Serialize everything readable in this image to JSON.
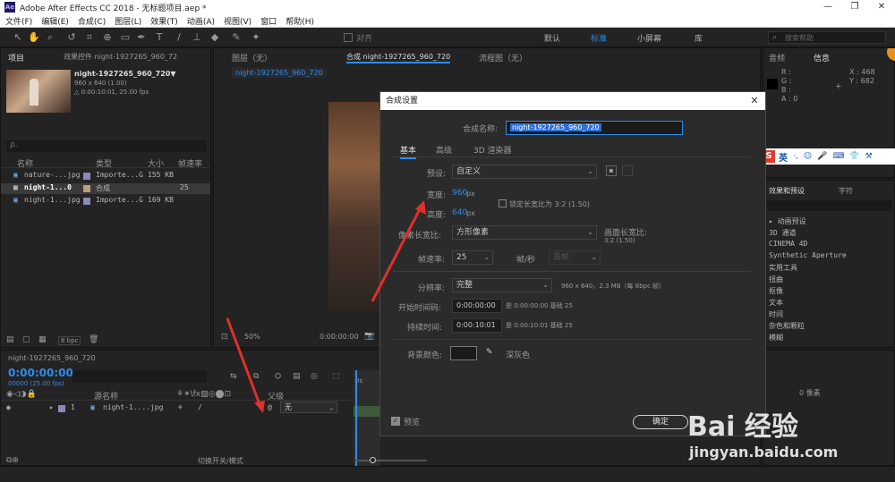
{
  "window": {
    "title": "Adobe After Effects CC 2018 - 无标题项目.aep *",
    "logo": "Ae",
    "controls": [
      "—",
      "❐",
      "✕"
    ]
  },
  "menu": [
    "文件(F)",
    "编辑(E)",
    "合成(C)",
    "图层(L)",
    "效果(T)",
    "动画(A)",
    "视图(V)",
    "窗口",
    "帮助(H)"
  ],
  "toolbar": {
    "align_label": "对齐",
    "workspaces": [
      "默认",
      "标准",
      "小屏幕",
      "库"
    ],
    "active_workspace": "标准",
    "search_placeholder": "搜索帮助",
    "accent_color": "#2d8ceb"
  },
  "project_panel": {
    "tab": "项目",
    "tab2": "效果控件 night-1927265_960_72",
    "selected_name": "night-1927265_960_720▼",
    "selected_info1": "960 x 640 (1.00)",
    "selected_info2": "△ 0:00:10:01, 25.00 fps",
    "search_placeholder": "ρ.",
    "columns": [
      "名称",
      "类型",
      "大小",
      "帧速率"
    ],
    "rows": [
      {
        "name": "nature-...jpg",
        "type": "Importe...G",
        "size": "155 KB",
        "fps": ""
      },
      {
        "name": "night-1...0",
        "type": "合成",
        "size": "",
        "fps": "25"
      },
      {
        "name": "night-1...jpg",
        "type": "Importe...G",
        "size": "169 KB",
        "fps": ""
      }
    ],
    "bpc": "8 bpc"
  },
  "comp_panel": {
    "tabs": [
      "图层（无）",
      "合成 night-1927265_960_720",
      "流程图（无）"
    ],
    "sub_tab": "night-1927265_960_720",
    "zoom": "50%",
    "time": "0:00:00:00"
  },
  "right_panel": {
    "tabs": [
      "音频",
      "信息"
    ],
    "info_labels": [
      "R :",
      "G :",
      "B :",
      "A : 0"
    ],
    "x": "X : 468",
    "y": "Y : 682",
    "effects_tabs": [
      "效果和预设",
      "字符"
    ],
    "effects": [
      "▸ 动画预设",
      "3D 通道",
      "CINEMA 4D",
      "Synthetic Aperture",
      "实用工具",
      "扭曲",
      "抠像",
      "文本",
      "时间",
      "杂色和颗粒",
      "模糊"
    ],
    "ime_label": "英",
    "percent": "0 像素"
  },
  "timeline": {
    "tab": "night-1927265_960_720",
    "timecode": "0:00:00:00",
    "frames": "00000 (25.00 fps)",
    "columns": [
      "源名称",
      "父级"
    ],
    "layer_index": "1",
    "layer_name": "night-1....jpg",
    "parent": "无",
    "switch_label": "切换开关/模式",
    "ruler_start": "0s"
  },
  "dialog": {
    "title": "合成设置",
    "name_label": "合成名称:",
    "name_value": "night-1927265_960_720",
    "tabs": [
      "基本",
      "高级",
      "3D 渲染器"
    ],
    "preset_label": "预设:",
    "preset_value": "自定义",
    "width_label": "宽度:",
    "width_value": "960",
    "width_unit": "px",
    "lock_label": "锁定长宽比为 3:2 (1.50)",
    "height_label": "高度:",
    "height_value": "640",
    "height_unit": "px",
    "par_label": "像素长宽比:",
    "par_value": "方形像素",
    "frame_aspect_label": "画面长宽比:",
    "frame_aspect_value": "3:2 (1.50)",
    "fps_label": "帧速率:",
    "fps_value": "25",
    "fps_unit": "帧/秒",
    "drop_frame": "丢帧",
    "resolution_label": "分辨率:",
    "resolution_value": "完整",
    "resolution_info": "960 x 640，2.3 MB（每 8bpc 帧）",
    "start_label": "开始时间码:",
    "start_value": "0:00:00:00",
    "start_note": "是 0:00:00:00  基础 25",
    "duration_label": "持续时间:",
    "duration_value": "0:00:10:01",
    "duration_note": "是 0:00:10:01  基础 25",
    "bg_label": "背景颜色:",
    "bg_name": "深灰色",
    "bg_color": "#1a1a1a",
    "preview_label": "预览",
    "ok_label": "确定"
  },
  "watermark": {
    "brand": "Bai 经验",
    "url": "jingyan.baidu.com"
  },
  "arrow_color": "#e0302a"
}
